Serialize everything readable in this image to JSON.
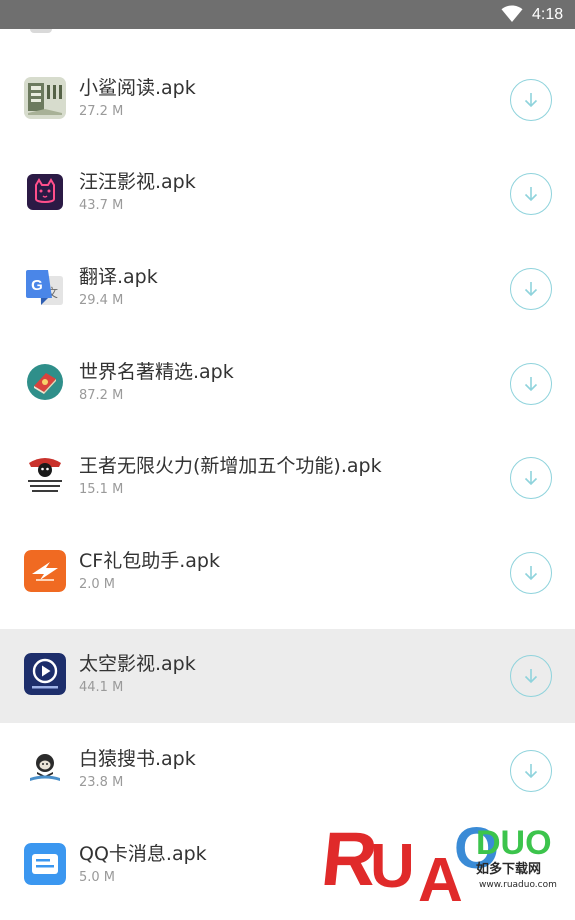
{
  "status_bar": {
    "time": "4:18"
  },
  "files": [
    {
      "name": "小鲨阅读.apk",
      "size": "27.2 M",
      "icon": "book-reader-icon",
      "selected": false
    },
    {
      "name": "汪汪影视.apk",
      "size": "43.7 M",
      "icon": "cat-face-icon",
      "selected": false
    },
    {
      "name": "翻译.apk",
      "size": "29.4 M",
      "icon": "google-translate-icon",
      "selected": false
    },
    {
      "name": "世界名著精选.apk",
      "size": "87.2 M",
      "icon": "classic-books-icon",
      "selected": false
    },
    {
      "name": "王者无限火力(新增加五个功能).apk",
      "size": "15.1 M",
      "icon": "meme-face-icon",
      "selected": false
    },
    {
      "name": "CF礼包助手.apk",
      "size": "2.0 M",
      "icon": "cf-logo-icon",
      "selected": false
    },
    {
      "name": "太空影视.apk",
      "size": "44.1 M",
      "icon": "play-button-icon",
      "selected": true
    },
    {
      "name": "白猿搜书.apk",
      "size": "23.8 M",
      "icon": "ape-reading-icon",
      "selected": false
    },
    {
      "name": "QQ卡消息.apk",
      "size": "5.0 M",
      "icon": "message-card-icon",
      "selected": false
    }
  ],
  "watermark": {
    "letters": [
      "R",
      "U",
      "A",
      "O",
      "DUO"
    ],
    "chinese": "如多下载网",
    "url": "www.ruaduo.com"
  },
  "colors": {
    "status_bar": "#6f6f6f",
    "download_ring": "#8fd3dc",
    "selected_row": "#ececec",
    "file_name": "#333333",
    "file_size": "#9a9a9a"
  }
}
